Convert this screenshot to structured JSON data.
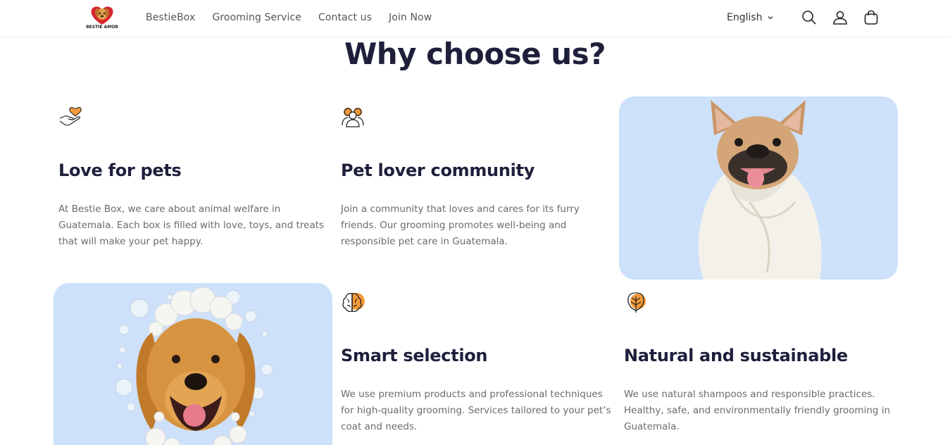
{
  "header": {
    "logo_text": "BESTIE AMOR",
    "nav": [
      "BestieBox",
      "Grooming Service",
      "Contact us",
      "Join Now"
    ],
    "language": "English",
    "icons": [
      "search-icon",
      "account-icon",
      "cart-icon"
    ]
  },
  "section": {
    "title": "Why choose us?"
  },
  "features": [
    {
      "icon": "heart-hand-icon",
      "title": "Love for pets",
      "text": "At Bestie Box, we care about animal welfare in Guatemala. Each box is filled with love, toys, and treats that will make your pet happy."
    },
    {
      "icon": "community-icon",
      "title": "Pet lover community",
      "text": "Join a community that loves and cares for its furry friends. Our grooming promotes well-being and responsible pet care in Guatemala."
    },
    {
      "icon": "brain-icon",
      "title": "Smart selection",
      "text": "We use premium products and professional techniques for high-quality grooming. Services tailored to your pet’s coat and needs."
    },
    {
      "icon": "leaf-icon",
      "title": "Natural and sustainable",
      "text": "We use natural shampoos and responsible practices. Healthy, safe, and environmentally friendly grooming in Guatemala."
    }
  ],
  "colors": {
    "accent": "#f29a3a",
    "card_bg": "#cde1fb",
    "title": "#1e1f3b",
    "body_text": "#6b6b6b"
  }
}
